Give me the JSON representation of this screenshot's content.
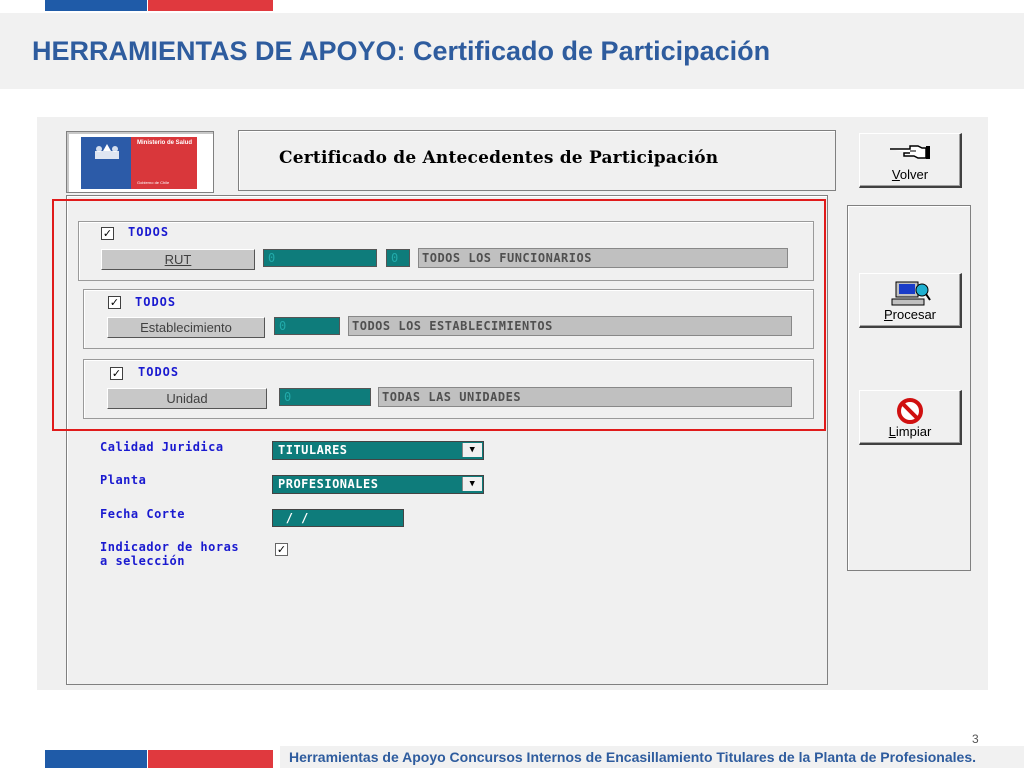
{
  "slide": {
    "title": "HERRAMIENTAS DE APOYO: Certificado de Participación",
    "footer": "Herramientas de Apoyo Concursos Internos de Encasillamiento Titulares de la Planta de Profesionales.",
    "page_number": "3",
    "colors": {
      "blue": "#1f5ba8",
      "red": "#e0393e",
      "title": "#2e5c9e"
    }
  },
  "app": {
    "logo": {
      "line1": "Ministerio de Salud",
      "line2": "Gobierno de Chile"
    },
    "heading": "Certificado de Antecedentes de Participación",
    "buttons": {
      "volver": {
        "label_u": "V",
        "label_rest": "olver",
        "icon": "pointing-hand-icon"
      },
      "procesar": {
        "label_u": "P",
        "label_rest": "rocesar",
        "icon": "computer-icon"
      },
      "limpiar": {
        "label_u": "L",
        "label_rest": "impiar",
        "icon": "no-entry-icon"
      }
    },
    "groups": [
      {
        "todos_label": "TODOS",
        "checked": true,
        "button": "RUT",
        "code": "0",
        "code2": "0",
        "description": "TODOS LOS FUNCIONARIOS"
      },
      {
        "todos_label": "TODOS",
        "checked": true,
        "button": "Establecimiento",
        "code": "0",
        "description": "TODOS LOS ESTABLECIMIENTOS"
      },
      {
        "todos_label": "TODOS",
        "checked": true,
        "button": "Unidad",
        "code": "0",
        "description": "TODAS LAS UNIDADES"
      }
    ],
    "fields": {
      "calidad_juridica": {
        "label": "Calidad Juridica",
        "value": "TITULARES"
      },
      "planta": {
        "label": "Planta",
        "value": "PROFESIONALES"
      },
      "fecha_corte": {
        "label": "Fecha Corte",
        "value": " / /"
      },
      "indicador": {
        "label_line1": "Indicador de horas",
        "label_line2": "a selección",
        "checked": true
      }
    }
  }
}
